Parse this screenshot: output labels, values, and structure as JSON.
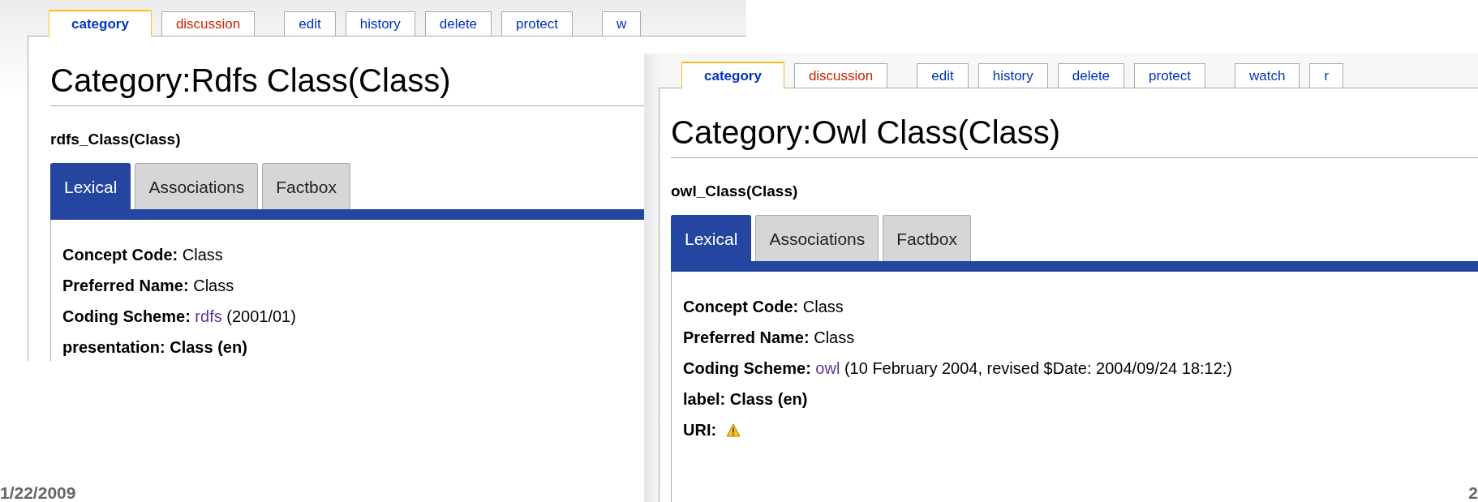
{
  "screenshots": [
    {
      "tab_groups": [
        [
          {
            "label": "category",
            "selected": true,
            "new": false
          },
          {
            "label": "discussion",
            "selected": false,
            "new": true
          }
        ],
        [
          {
            "label": "edit",
            "selected": false,
            "new": false
          },
          {
            "label": "history",
            "selected": false,
            "new": false
          },
          {
            "label": "delete",
            "selected": false,
            "new": false
          },
          {
            "label": "protect",
            "selected": false,
            "new": false
          }
        ],
        [
          {
            "label": "w",
            "selected": false,
            "new": false
          }
        ]
      ],
      "title": "Category:Rdfs Class(Class)",
      "subtitle": "rdfs_Class(Class)",
      "panel_tabs": [
        {
          "label": "Lexical",
          "selected": true
        },
        {
          "label": "Associations",
          "selected": false
        },
        {
          "label": "Factbox",
          "selected": false
        }
      ],
      "fields": [
        {
          "kind": "text",
          "label": "Concept Code:",
          "value": "Class"
        },
        {
          "kind": "text",
          "label": "Preferred Name:",
          "value": "Class"
        },
        {
          "kind": "link",
          "label": "Coding Scheme:",
          "link": "rdfs",
          "value": "(2001/01)"
        },
        {
          "kind": "bold",
          "label": "presentation:",
          "value": "Class (en)"
        }
      ]
    },
    {
      "tab_groups": [
        [
          {
            "label": "category",
            "selected": true,
            "new": false
          },
          {
            "label": "discussion",
            "selected": false,
            "new": true
          }
        ],
        [
          {
            "label": "edit",
            "selected": false,
            "new": false
          },
          {
            "label": "history",
            "selected": false,
            "new": false
          },
          {
            "label": "delete",
            "selected": false,
            "new": false
          },
          {
            "label": "protect",
            "selected": false,
            "new": false
          }
        ],
        [
          {
            "label": "watch",
            "selected": false,
            "new": false
          },
          {
            "label": "r",
            "selected": false,
            "new": false
          }
        ]
      ],
      "title": "Category:Owl Class(Class)",
      "subtitle": "owl_Class(Class)",
      "panel_tabs": [
        {
          "label": "Lexical",
          "selected": true
        },
        {
          "label": "Associations",
          "selected": false
        },
        {
          "label": "Factbox",
          "selected": false
        }
      ],
      "fields": [
        {
          "kind": "text",
          "label": "Concept Code:",
          "value": "Class"
        },
        {
          "kind": "text",
          "label": "Preferred Name:",
          "value": "Class"
        },
        {
          "kind": "link",
          "label": "Coding Scheme:",
          "link": "owl",
          "value": "(10 February 2004, revised $Date: 2004/09/24 18:12:)"
        },
        {
          "kind": "bold",
          "label": "label:",
          "value": "Class (en)"
        },
        {
          "kind": "warning",
          "label": "URI:"
        }
      ]
    }
  ],
  "footer": {
    "date": "1/22/2009",
    "page_number": "2"
  }
}
